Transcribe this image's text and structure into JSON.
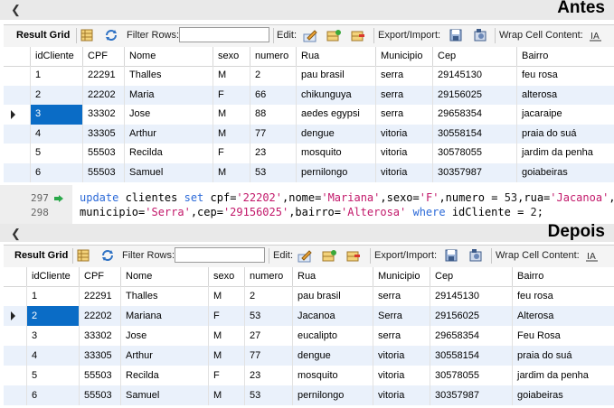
{
  "before": {
    "caption": "Antes",
    "toolbar": {
      "result_grid": "Result Grid",
      "filter_rows": "Filter Rows:",
      "edit": "Edit:",
      "export_import": "Export/Import:",
      "wrap_cell": "Wrap Cell Content:"
    },
    "columns": [
      "idCliente",
      "CPF",
      "Nome",
      "sexo",
      "numero",
      "Rua",
      "Municipio",
      "Cep",
      "Bairro"
    ],
    "rows": [
      [
        "1",
        "22291",
        "Thalles",
        "M",
        "2",
        "pau brasil",
        "serra",
        "29145130",
        "feu rosa"
      ],
      [
        "2",
        "22202",
        "Maria",
        "F",
        "66",
        "chikunguya",
        "serra",
        "29156025",
        "alterosa"
      ],
      [
        "3",
        "33302",
        "Jose",
        "M",
        "88",
        "aedes egypsi",
        "serra",
        "29658354",
        "jacaraipe"
      ],
      [
        "4",
        "33305",
        "Arthur",
        "M",
        "77",
        "dengue",
        "vitoria",
        "30558154",
        "praia do suá"
      ],
      [
        "5",
        "55503",
        "Recilda",
        "F",
        "23",
        "mosquito",
        "vitoria",
        "30578055",
        "jardim da penha"
      ],
      [
        "6",
        "55503",
        "Samuel",
        "M",
        "53",
        "pernilongo",
        "vitoria",
        "30357987",
        "goiabeiras"
      ]
    ]
  },
  "editor": {
    "line1_no": "297",
    "line2_no": "298",
    "line1": {
      "kw1": "update",
      "t1": " clientes ",
      "kw2": "set",
      "t2": " cpf=",
      "s1": "'22202'",
      "t3": ",nome=",
      "s2": "'Mariana'",
      "t4": ",sexo=",
      "s3": "'F'",
      "t5": ",numero = ",
      "n1": "53",
      "t6": ",rua=",
      "s4": "'Jacanoa'",
      "t7": ","
    },
    "line2": {
      "t1": "municipio=",
      "s1": "'Serra'",
      "t2": ",cep=",
      "s2": "'29156025'",
      "t3": ",bairro=",
      "s3": "'Alterosa'",
      "t4": " ",
      "kw1": "where",
      "t5": " idCliente = ",
      "n1": "2",
      "t6": ";"
    }
  },
  "after": {
    "caption": "Depois",
    "toolbar": {
      "result_grid": "Result Grid",
      "filter_rows": "Filter Rows:",
      "edit": "Edit:",
      "export_import": "Export/Import:",
      "wrap_cell": "Wrap Cell Content:"
    },
    "columns": [
      "idCliente",
      "CPF",
      "Nome",
      "sexo",
      "numero",
      "Rua",
      "Municipio",
      "Cep",
      "Bairro"
    ],
    "rows": [
      [
        "1",
        "22291",
        "Thalles",
        "M",
        "2",
        "pau brasil",
        "serra",
        "29145130",
        "feu rosa"
      ],
      [
        "2",
        "22202",
        "Mariana",
        "F",
        "53",
        "Jacanoa",
        "Serra",
        "29156025",
        "Alterosa"
      ],
      [
        "3",
        "33302",
        "Jose",
        "M",
        "27",
        "eucalipto",
        "serra",
        "29658354",
        "Feu Rosa"
      ],
      [
        "4",
        "33305",
        "Arthur",
        "M",
        "77",
        "dengue",
        "vitoria",
        "30558154",
        "praia do suá"
      ],
      [
        "5",
        "55503",
        "Recilda",
        "F",
        "23",
        "mosquito",
        "vitoria",
        "30578055",
        "jardim da penha"
      ],
      [
        "6",
        "55503",
        "Samuel",
        "M",
        "53",
        "pernilongo",
        "vitoria",
        "30357987",
        "goiabeiras"
      ]
    ]
  },
  "icon_names": [
    "grid-icon",
    "refresh-icon",
    "edit-row-icon",
    "add-row-icon",
    "delete-row-icon",
    "export-icon",
    "import-icon",
    "wrap-icon",
    "run-arrow-icon",
    "chevron-left-icon"
  ],
  "colors": {
    "selection": "#0a6cc6",
    "alt_row": "#eaf1fb",
    "keyword": "#2c6ad8",
    "string": "#c2186a"
  }
}
